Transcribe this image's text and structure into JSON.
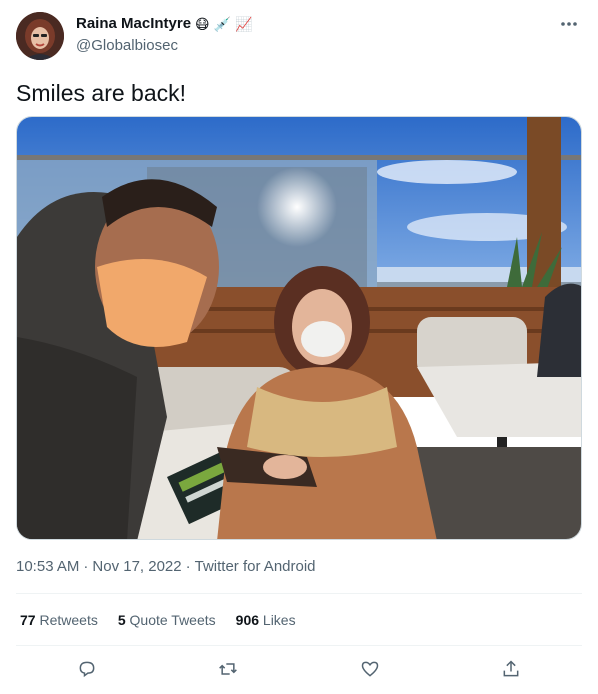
{
  "author": {
    "display_name": "Raina MacIntyre",
    "emojis": [
      "😷",
      "💉",
      "📈"
    ],
    "handle": "@Globalbiosec"
  },
  "tweet": {
    "text": "Smiles are back!",
    "time": "10:53 AM",
    "date": "Nov 17, 2022",
    "source": "Twitter for Android",
    "separator": "·"
  },
  "stats": {
    "retweets": {
      "count": "77",
      "label": "Retweets"
    },
    "quotes": {
      "count": "5",
      "label": "Quote Tweets"
    },
    "likes": {
      "count": "906",
      "label": "Likes"
    }
  },
  "actions": [
    "reply-icon",
    "retweet-icon",
    "like-icon",
    "share-icon"
  ],
  "colors": {
    "secondary_text": "#536471",
    "primary_text": "#0f1419",
    "divider": "#eff3f4",
    "icon": "#536471"
  }
}
